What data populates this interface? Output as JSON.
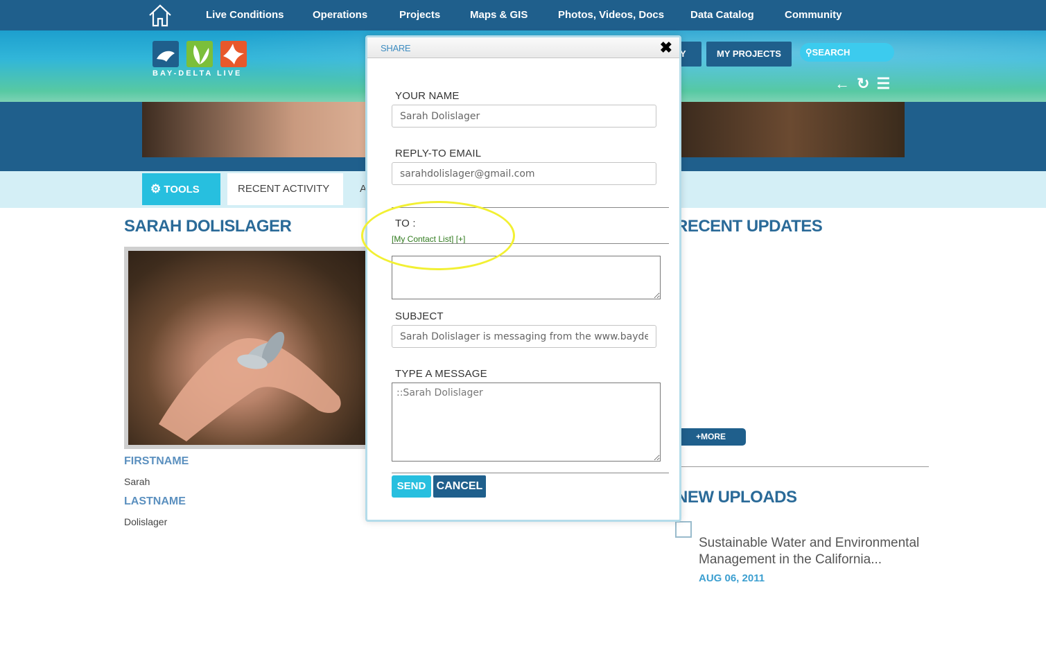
{
  "topnav": {
    "home_icon": "home-icon",
    "items": [
      "Live Conditions",
      "Operations",
      "Projects",
      "Maps & GIS",
      "Photos, Videos, Docs",
      "Data Catalog",
      "Community"
    ]
  },
  "header": {
    "logo_text": "BAY-DELTA LIVE",
    "partial_button": "Y",
    "my_projects": "MY PROJECTS",
    "search_label": "SEARCH",
    "icons": [
      "back-arrow-icon",
      "refresh-icon",
      "list-icon"
    ]
  },
  "tabs": {
    "tools": "TOOLS",
    "recent_activity": "RECENT ACTIVITY",
    "partial": "A"
  },
  "profile": {
    "name": "SARAH DOLISLAGER",
    "firstname_label": "FIRSTNAME",
    "firstname": "Sarah",
    "lastname_label": "LASTNAME",
    "lastname": "Dolislager"
  },
  "recent_updates": {
    "title": "RECENT UPDATES",
    "more": "+MORE"
  },
  "new_uploads": {
    "title": "NEW UPLOADS",
    "items": [
      {
        "title": "Sustainable Water and Environmental Management in the California...",
        "date": "AUG 06, 2011"
      }
    ]
  },
  "modal": {
    "title": "SHARE",
    "close": "✖",
    "your_name_label": "YOUR NAME",
    "your_name": "Sarah Dolislager",
    "reply_email_label": "REPLY-TO EMAIL",
    "reply_email": "sarahdolislager@gmail.com",
    "to_label": "TO :",
    "contact_list": "[My Contact List] [+]",
    "to_value": "",
    "subject_label": "SUBJECT",
    "subject": "Sarah Dolislager is messaging from the www.baydelt",
    "message_label": "TYPE A MESSAGE",
    "message": "::Sarah Dolislager",
    "send": "SEND",
    "cancel": "CANCEL"
  },
  "colors": {
    "nav_blue": "#1f5f8c",
    "accent_cyan": "#27bfdf",
    "title_blue": "#2a6a98",
    "highlight_yellow": "#f2f033"
  }
}
